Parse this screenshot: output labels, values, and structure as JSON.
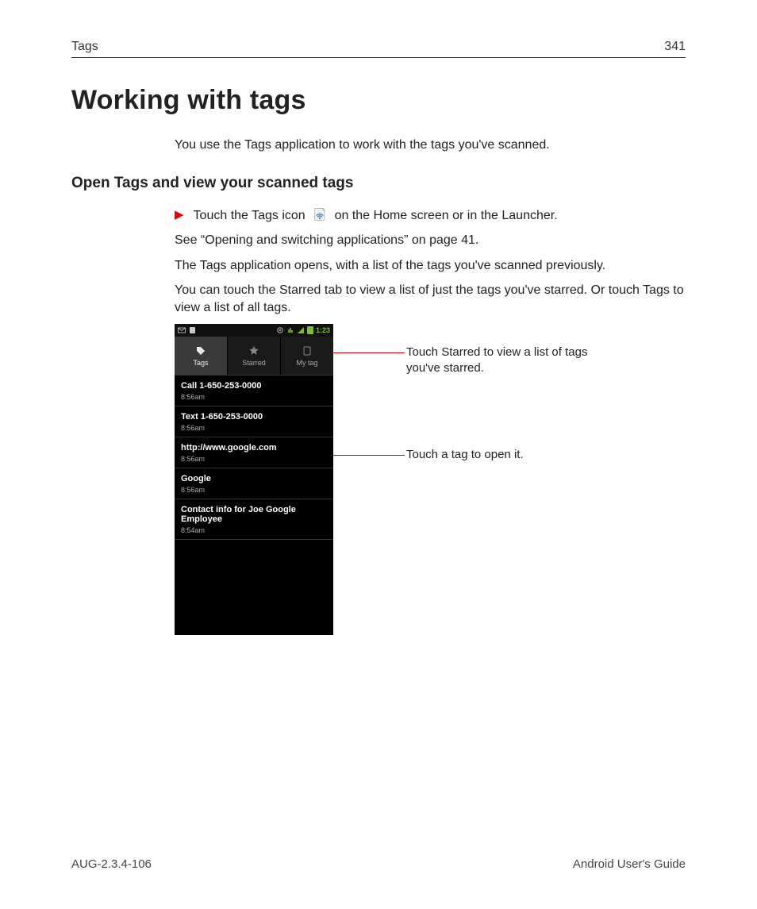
{
  "header": {
    "section": "Tags",
    "page": "341"
  },
  "title": "Working with tags",
  "intro": "You use the Tags application to work with the tags you've scanned.",
  "sectionHeading": "Open Tags and view your scanned tags",
  "step_pre": "Touch the Tags icon",
  "step_post": " on the Home screen or in the Launcher.",
  "p1": "See “Opening and switching applications” on page 41.",
  "p2": "The Tags application opens, with a list of the tags you've scanned previously.",
  "p3": "You can touch the Starred tab to view a list of just the tags you've starred. Or touch Tags to view a list of all tags.",
  "phone": {
    "time": "1:23",
    "tabs": {
      "tags": "Tags",
      "starred": "Starred",
      "mytag": "My tag"
    },
    "rows": [
      {
        "t": "Call 1-650-253-0000",
        "s": "8:56am"
      },
      {
        "t": "Text 1-650-253-0000",
        "s": "8:56am"
      },
      {
        "t": "http://www.google.com",
        "s": "8:56am"
      },
      {
        "t": "Google",
        "s": "8:56am"
      },
      {
        "t": "Contact info for Joe Google Employee",
        "s": "8:54am"
      }
    ]
  },
  "callout1": "Touch Starred to view a list of tags you've starred.",
  "callout2": "Touch a tag to open it.",
  "footer": {
    "left": "AUG-2.3.4-106",
    "right": "Android User's Guide"
  }
}
